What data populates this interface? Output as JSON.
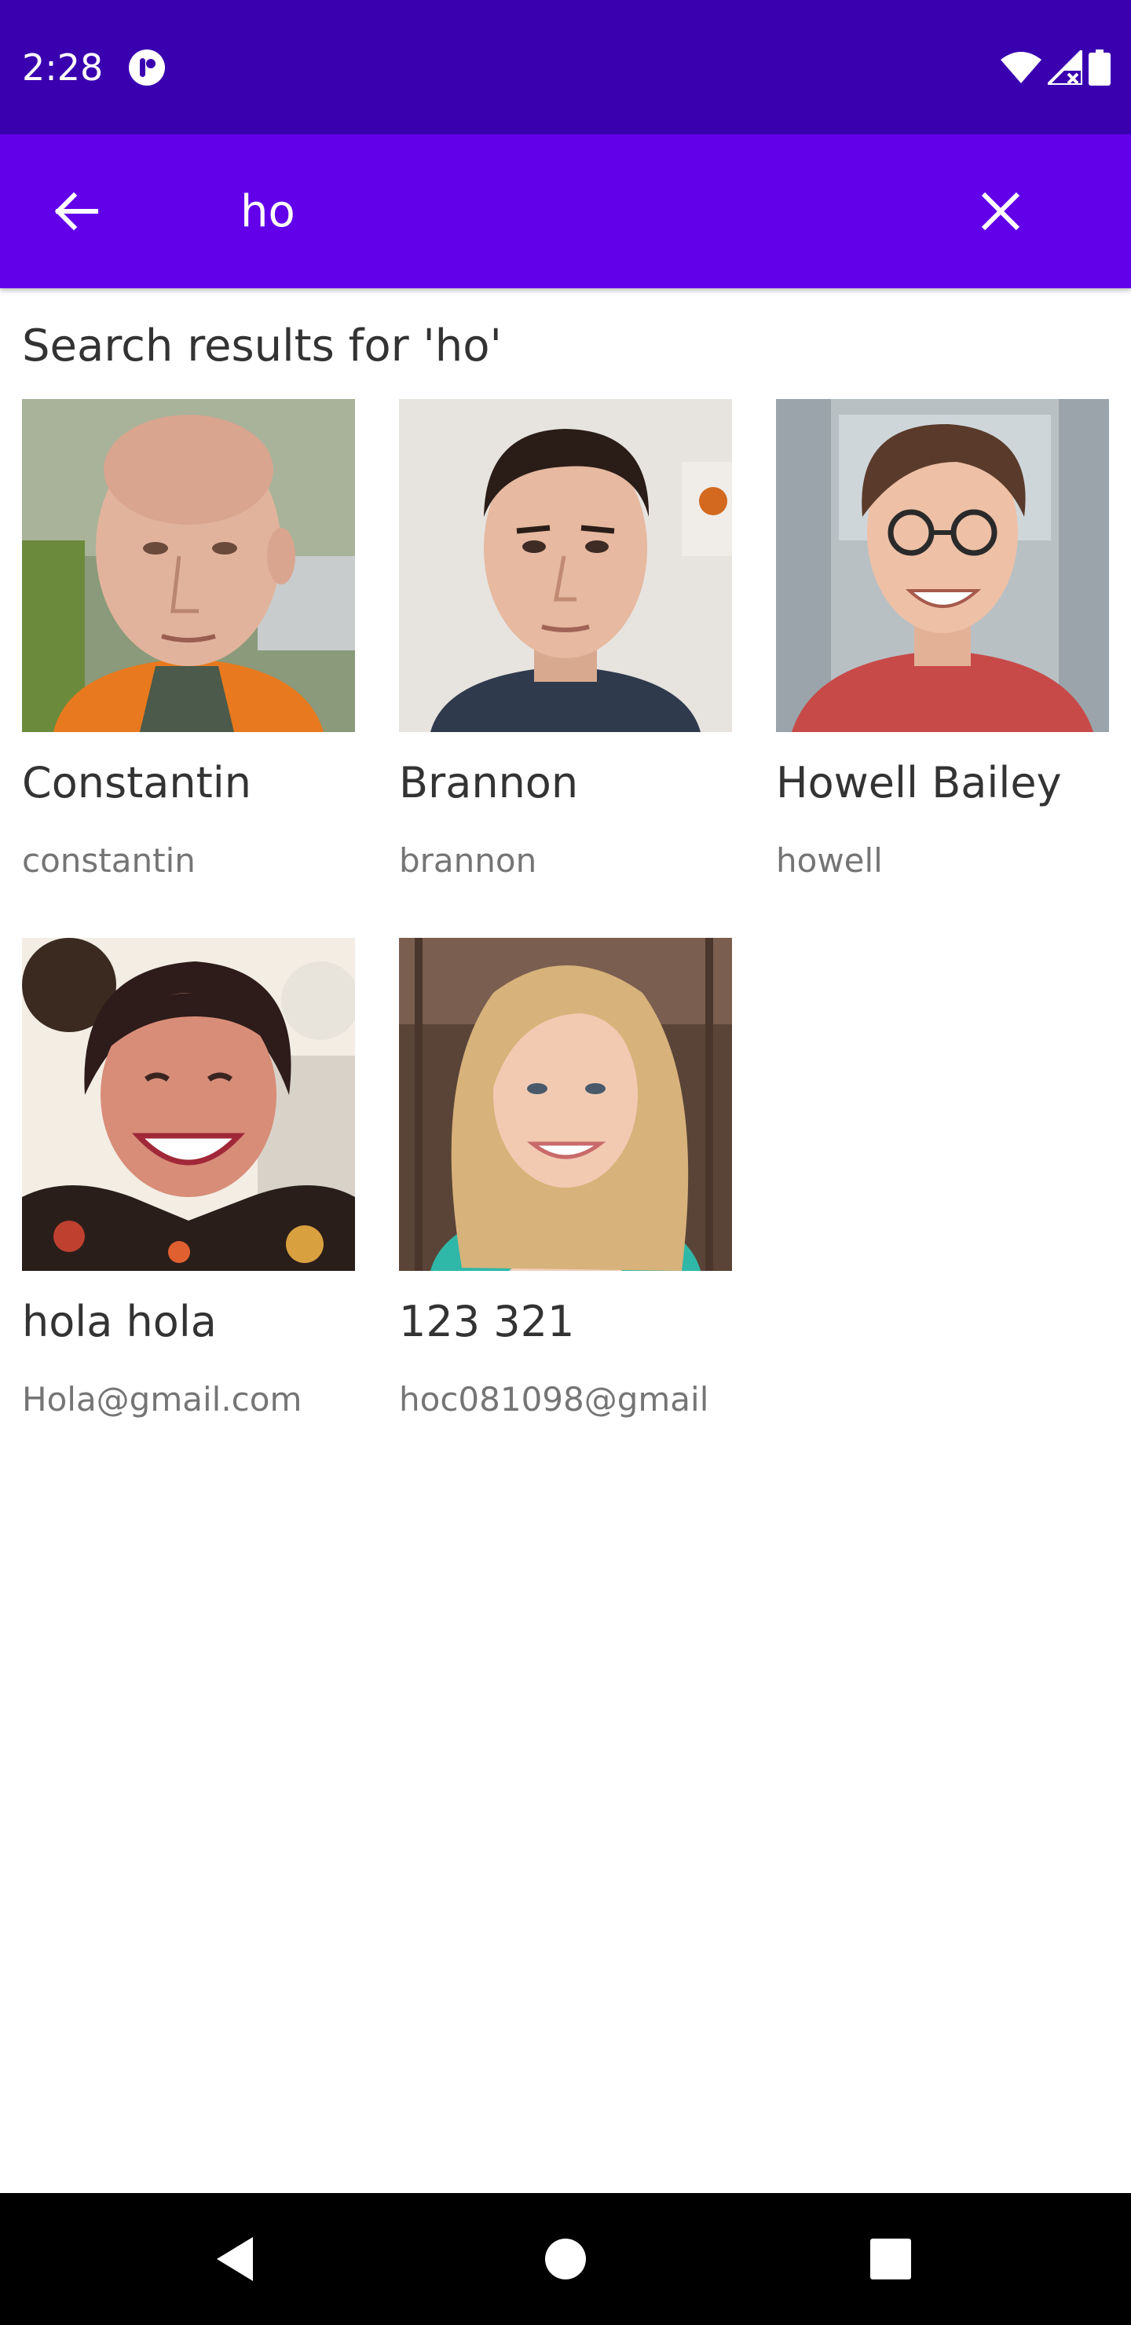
{
  "status_bar": {
    "time": "2:28",
    "app_icon": "pocket-app-icon",
    "wifi_icon": "wifi-icon",
    "signal_icon": "signal-icon",
    "battery_icon": "battery-icon"
  },
  "app_bar": {
    "back_icon": "arrow-left-icon",
    "search_value": "ho",
    "clear_icon": "close-icon",
    "color": "#6200ea"
  },
  "results": {
    "heading": "Search results for 'ho'",
    "items": [
      {
        "name": "Constantin",
        "username": "constantin"
      },
      {
        "name": "Brannon",
        "username": "brannon"
      },
      {
        "name": "Howell Bailey",
        "username": "howell"
      },
      {
        "name": "hola hola",
        "username": "Hola@gmail.com"
      },
      {
        "name": "123 321",
        "username": "hoc081098@gmail"
      }
    ]
  },
  "nav_bar": {
    "back_icon": "nav-back-icon",
    "home_icon": "nav-home-icon",
    "recents_icon": "nav-recents-icon"
  },
  "colors": {
    "status_bar": "#3a00b0",
    "app_bar": "#6200ea",
    "primary_text": "#333333",
    "secondary_text": "#757575"
  }
}
